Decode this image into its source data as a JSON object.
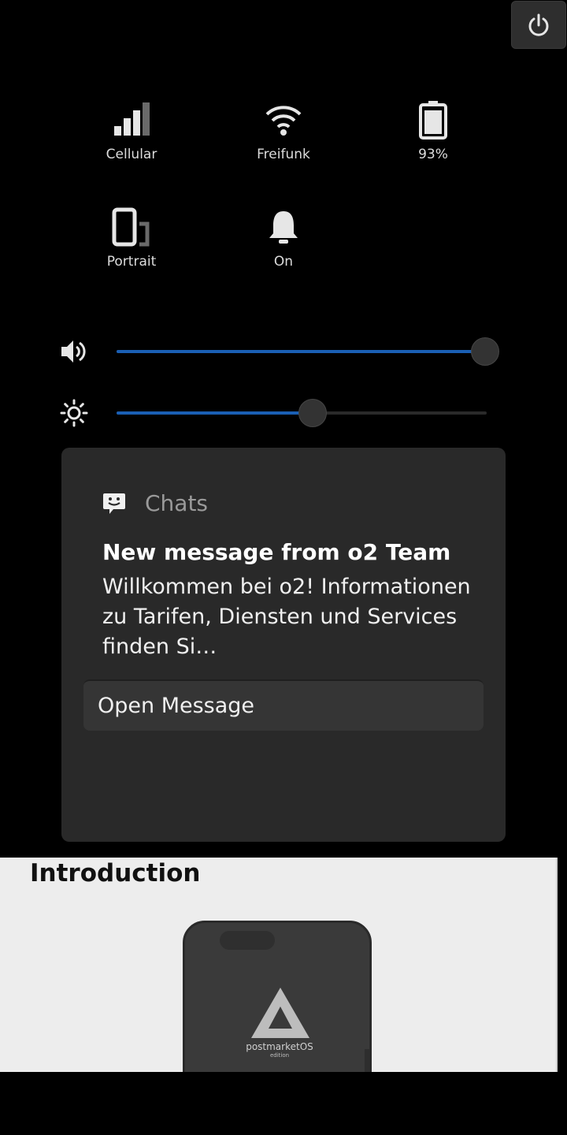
{
  "quick_settings": {
    "tiles": [
      {
        "label": "Cellular",
        "icon": "signal-icon"
      },
      {
        "label": "Freifunk",
        "icon": "wifi-icon"
      },
      {
        "label": "93%",
        "icon": "battery-icon"
      },
      {
        "label": "Portrait",
        "icon": "rotation-icon"
      },
      {
        "label": "On",
        "icon": "bell-icon"
      }
    ],
    "volume": {
      "icon": "volume-icon",
      "level": 1.0
    },
    "brightness": {
      "icon": "brightness-icon",
      "level": 0.53
    }
  },
  "notification": {
    "app_name": "Chats",
    "title": "New message from o2 Team",
    "body": "Willkommen bei o2! Informationen zu Tarifen, Diensten und Services finden Si…",
    "action_label": "Open Message"
  },
  "background_page": {
    "heading": "Introduction",
    "image_caption": "postmarketOS",
    "image_subcaption": "edition"
  },
  "colors": {
    "accent": "#1a5fb4",
    "panel_bg": "#000000",
    "card_bg": "#292929"
  }
}
